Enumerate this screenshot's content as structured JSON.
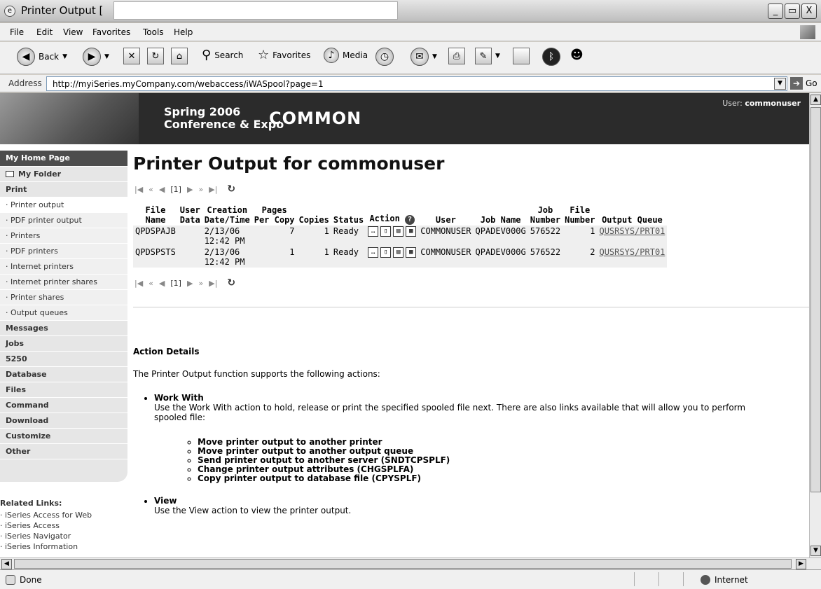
{
  "window": {
    "title": "Printer Output [",
    "controls": [
      "_",
      "▭",
      "X"
    ]
  },
  "menu": [
    "File",
    "Edit",
    "View",
    "Favorites",
    "Tools",
    "Help"
  ],
  "toolbar": {
    "back": "Back",
    "search": "Search",
    "favorites": "Favorites",
    "media": "Media"
  },
  "address": {
    "label": "Address",
    "url": "http://myiSeries.myCompany.com/webaccess/iWASpool?page=1",
    "go": "Go"
  },
  "banner": {
    "line1": "Spring 2006",
    "line2": "Conference & Expo",
    "brand": "COMMON",
    "user_label": "User:",
    "user_name": "commonuser"
  },
  "nav": {
    "home": "My Home Page",
    "folder": "My Folder",
    "print": "Print",
    "print_items": [
      "Printer output",
      "PDF printer output",
      "Printers",
      "PDF printers",
      "Internet printers",
      "Internet printer shares",
      "Printer shares",
      "Output queues"
    ],
    "categories": [
      "Messages",
      "Jobs",
      "5250",
      "Database",
      "Files",
      "Command",
      "Download",
      "Customize",
      "Other"
    ]
  },
  "related": {
    "heading": "Related Links:",
    "links": [
      "iSeries Access for Web",
      "iSeries Access",
      "iSeries Navigator",
      "iSeries Information"
    ]
  },
  "main": {
    "title": "Printer Output for commonuser",
    "page_indicator": "[1]"
  },
  "table": {
    "headers": {
      "file_name": [
        "File",
        "Name"
      ],
      "user_data": [
        "User",
        "Data"
      ],
      "creation": [
        "Creation",
        "Date/Time"
      ],
      "pages": [
        "Pages",
        "Per Copy"
      ],
      "copies": "Copies",
      "status": "Status",
      "action": "Action",
      "user": "User",
      "job_name": "Job Name",
      "job_number": [
        "Job",
        "Number"
      ],
      "file_number": [
        "File",
        "Number"
      ],
      "output_queue": "Output Queue"
    },
    "rows": [
      {
        "file": "QPDSPAJB",
        "date": "2/13/06",
        "time": "12:42 PM",
        "pages": "7",
        "copies": "1",
        "status": "Ready",
        "user": "COMMONUSER",
        "job_name": "QPADEV000G",
        "job_number": "576522",
        "file_number": "1",
        "queue": "QUSRSYS/PRT01"
      },
      {
        "file": "QPDSPSTS",
        "date": "2/13/06",
        "time": "12:42 PM",
        "pages": "1",
        "copies": "1",
        "status": "Ready",
        "user": "COMMONUSER",
        "job_name": "QPADEV000G",
        "job_number": "576522",
        "file_number": "2",
        "queue": "QUSRSYS/PRT01"
      }
    ]
  },
  "details": {
    "heading": "Action Details",
    "intro": "The Printer Output function supports the following actions:",
    "work_with_title": "Work With",
    "work_with_text": "Use the Work With action to hold, release or print the specified spooled file next. There are also links available that will allow you to perform",
    "work_with_text2": "spooled file:",
    "sub_items": [
      "Move printer output to another printer",
      "Move printer output to another output queue",
      "Send printer output to another server (SNDTCPSPLF)",
      "Change printer output attributes (CHGSPLFA)",
      "Copy printer output to database file (CPYSPLF)"
    ],
    "view_title": "View",
    "view_text": "Use the View action to view the printer output."
  },
  "status": {
    "left": "Done",
    "zone": "Internet"
  }
}
